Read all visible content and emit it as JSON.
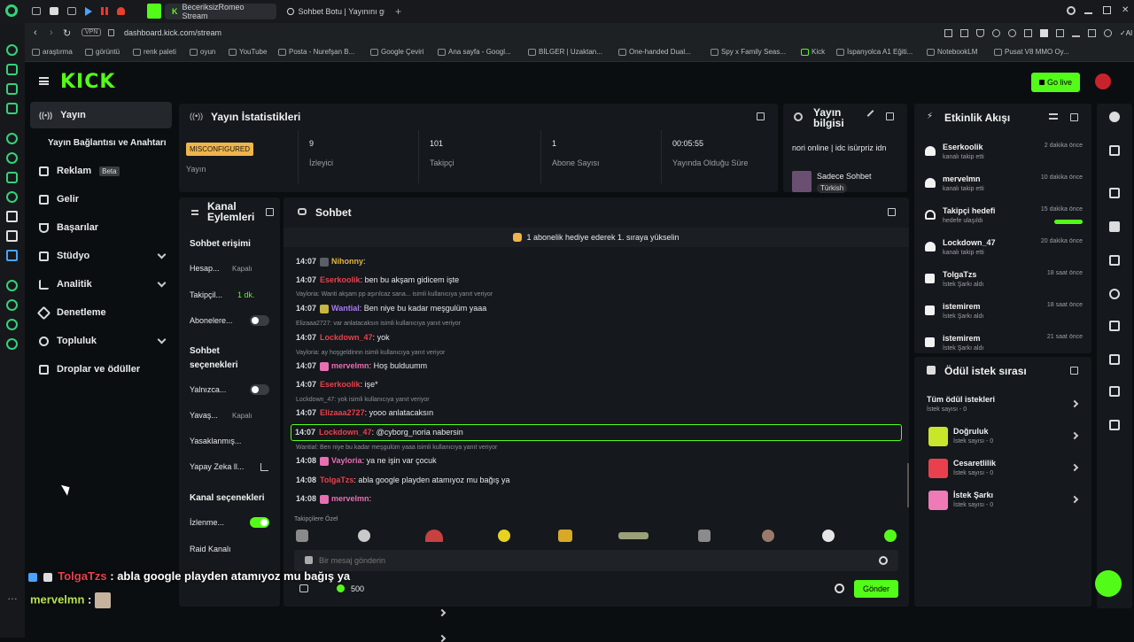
{
  "browser": {
    "tabs": [
      {
        "label": "BeceriksizRomeo Stream"
      },
      {
        "label": "Sohbet Botu | Yayınını güç"
      }
    ],
    "url": "dashboard.kick.com/stream",
    "vpn_label": "VPN",
    "bookmarks": [
      "araştırma",
      "görüntü",
      "renk paleti",
      "oyun",
      "YouTube",
      "Posta - Nurefşan B...",
      "Google Çeviri",
      "Ana sayfa - Googl...",
      "BİLGER | Uzaktan...",
      "One-handed Dual...",
      "Spy x Family Seas...",
      "Kick",
      "İspanyolca A1 Eğiti...",
      "NotebookLM",
      "Pusat V8 MMO Oy..."
    ]
  },
  "header": {
    "logo": "KICK",
    "go_live": "Go live"
  },
  "nav": {
    "items": [
      {
        "label": "Yayın"
      },
      {
        "label": "Yayın Bağlantısı ve Anahtarı"
      },
      {
        "label": "Reklam",
        "badge": "Beta"
      },
      {
        "label": "Gelir"
      },
      {
        "label": "Başarılar"
      },
      {
        "label": "Stüdyo"
      },
      {
        "label": "Analitik"
      },
      {
        "label": "Denetleme"
      },
      {
        "label": "Topluluk"
      },
      {
        "label": "Droplar ve ödüller"
      }
    ]
  },
  "stats": {
    "title": "Yayın İstatistikleri",
    "status_badge": "MISCONFIGURED",
    "status_label": "Yayın",
    "cells": [
      {
        "value": "9",
        "label": "İzleyici"
      },
      {
        "value": "101",
        "label": "Takipçi"
      },
      {
        "value": "1",
        "label": "Abone Sayısı"
      },
      {
        "value": "00:05:55",
        "label": "Yayında Olduğu Süre"
      }
    ]
  },
  "stream_info": {
    "title": "Yayın bilgisi",
    "stream_title": "nori online | idc isürpriz idn",
    "category": "Sadece Sohbet",
    "language": "Türkish"
  },
  "events": {
    "title": "Etkinlik Akışı",
    "items": [
      {
        "name": "Eserkoolik",
        "sub": "kanalı takip etti",
        "time": "2 dakika önce"
      },
      {
        "name": "mervelmn",
        "sub": "kanalı takip etti",
        "time": "10 dakika önce"
      },
      {
        "name": "Takipçi hedefi",
        "sub": "hedefe ulaşıldı",
        "time": "15 dakika önce"
      },
      {
        "name": "Lockdown_47",
        "sub": "kanalı takip etti",
        "time": "20 dakika önce"
      },
      {
        "name": "TolgaTzs",
        "sub": "İstek Şarkı aldı",
        "time": "18 saat önce"
      },
      {
        "name": "istemirem",
        "sub": "İstek Şarkı aldı",
        "time": "18 saat önce"
      },
      {
        "name": "istemirem",
        "sub": "İstek Şarkı aldı",
        "time": "21 saat önce"
      }
    ]
  },
  "rewards": {
    "title": "Ödül istek sırası",
    "items": [
      {
        "name": "Tüm ödül istekleri",
        "sub": "İstek sayısı - 0",
        "color": ""
      },
      {
        "name": "Doğruluk",
        "sub": "İstek sayısı - 0",
        "color": "#c8e62a"
      },
      {
        "name": "Cesaretlilik",
        "sub": "İstek sayısı - 0",
        "color": "#e8414d"
      },
      {
        "name": "İstek Şarkı",
        "sub": "İstek sayısı - 0",
        "color": "#f07ab8"
      }
    ]
  },
  "channel_actions": {
    "title": "Kanal Eylemleri",
    "section1": "Sohbet erişimi",
    "rows1": [
      {
        "label": "Hesap...",
        "value": "Kapalı"
      },
      {
        "label": "Takipçil...",
        "value": "1 dk."
      },
      {
        "label": "Abonelere...",
        "value": ""
      }
    ],
    "section2": "Sohbet seçenekleri",
    "rows2": [
      {
        "label": "Yalnızca...",
        "value": ""
      },
      {
        "label": "Yavaş...",
        "value": "Kapalı"
      },
      {
        "label": "Yasaklanmış...",
        "value": ""
      },
      {
        "label": "Yapay Zeka ll...",
        "value": ""
      }
    ],
    "section3": "Kanal seçenekleri",
    "rows3": [
      {
        "label": "İzlenme...",
        "value": ""
      },
      {
        "label": "Raid Kanalı",
        "value": ""
      }
    ]
  },
  "chat": {
    "title": "Sohbet",
    "banner": "1 abonelik hediye ederek 1. sıraya yükselin",
    "lines": [
      {
        "type": "msg",
        "time": "14:07",
        "user": "Nihonny",
        "ucls": "u-yellow",
        "text": ""
      },
      {
        "type": "msg",
        "time": "14:07",
        "user": "Eserkoolik",
        "ucls": "u-red",
        "text": "ben bu akşam gidicem işte"
      },
      {
        "type": "reply",
        "text": "Vayloria: Wanti akşam pp aşırılcaz sana... isimli kullanıcıya yanıt veriyor"
      },
      {
        "type": "msg",
        "time": "14:07",
        "user": "Wantial",
        "ucls": "u-purple",
        "text": "Ben niye bu kadar meşgulüm yaaa"
      },
      {
        "type": "reply",
        "text": "Elizaaa2727: var anlatacaksın isimli kullanıcıya yanıt veriyor"
      },
      {
        "type": "msg",
        "time": "14:07",
        "user": "Lockdown_47",
        "ucls": "u-red",
        "text": "yok"
      },
      {
        "type": "reply",
        "text": "Vayloria: ay hoşgeldinnn isimli kullanıcıya yanıt veriyor"
      },
      {
        "type": "msg",
        "time": "14:07",
        "user": "mervelmn",
        "ucls": "u-pink",
        "text": "Hoş bulduumm"
      },
      {
        "type": "msg",
        "time": "14:07",
        "user": "Eserkoolik",
        "ucls": "u-red",
        "text": "işe*"
      },
      {
        "type": "reply",
        "text": "Lockdown_47: yok isimli kullanıcıya yanıt veriyor"
      },
      {
        "type": "msg",
        "time": "14:07",
        "user": "Elizaaa2727",
        "ucls": "u-red",
        "text": "yooo anlatacaksın"
      },
      {
        "type": "highlight",
        "time": "14:07",
        "user": "Lockdown_47",
        "ucls": "u-red",
        "text": "@cyborg_noria nabersin"
      },
      {
        "type": "reply",
        "text": "Wantial: Ben niye bu kadar meşgulüm yaaa isimli kullanıcıya yanıt veriyor"
      },
      {
        "type": "msg",
        "time": "14:08",
        "user": "Vayloria",
        "ucls": "u-pink",
        "text": "ya ne işin var çocuk"
      },
      {
        "type": "msg",
        "time": "14:08",
        "user": "TolgaTzs",
        "ucls": "u-red",
        "text": "abla google playden atamıyoz mu bağış ya"
      },
      {
        "type": "msg",
        "time": "14:08",
        "user": "mervelmn",
        "ucls": "u-pink",
        "text": ""
      }
    ],
    "emote_label": "Takipçilere Özel",
    "input_placeholder": "Bir mesaj gönderin",
    "points": "500",
    "send": "Gönder"
  },
  "overlay": {
    "line1_user": "TolgaTzs",
    "line1_text": ": abla google playden atamıyoz mu bağış ya",
    "line2_user": "mervelmn",
    "line2_text": ":"
  },
  "colors": {
    "accent": "#53fc18",
    "panel": "#15181c"
  }
}
